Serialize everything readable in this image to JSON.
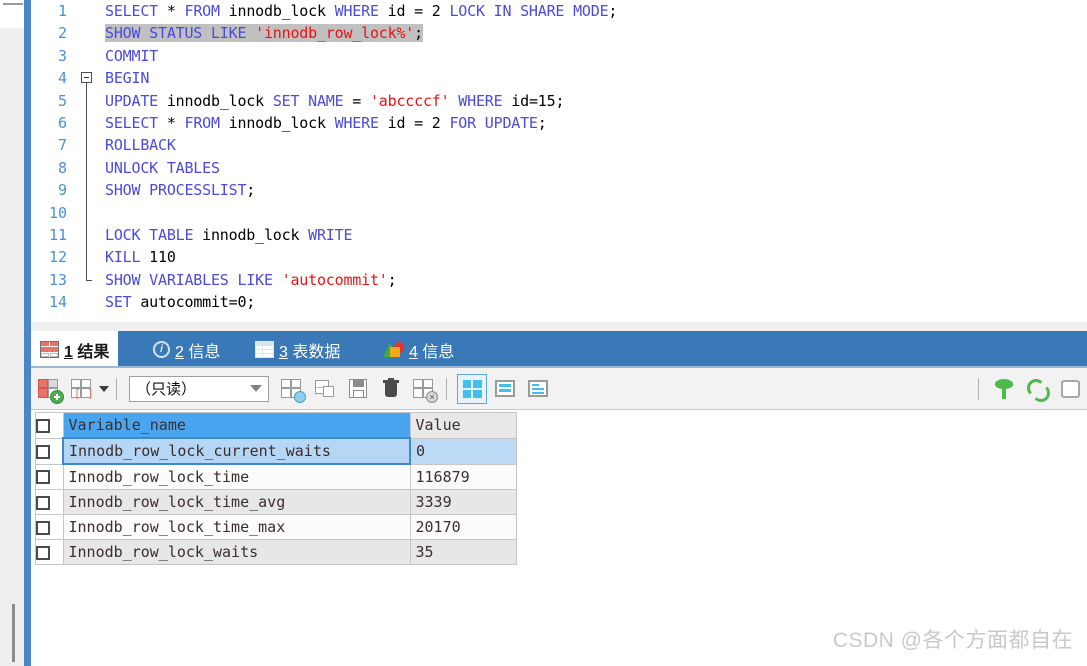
{
  "editor": {
    "lines": [
      {
        "n": "1",
        "segments": [
          {
            "t": "SELECT",
            "c": "kw"
          },
          {
            "t": " * ",
            "c": "pl"
          },
          {
            "t": "FROM",
            "c": "kw"
          },
          {
            "t": " innodb_lock ",
            "c": "pl"
          },
          {
            "t": "WHERE",
            "c": "kw"
          },
          {
            "t": " id = 2 ",
            "c": "pl"
          },
          {
            "t": "LOCK IN SHARE MODE",
            "c": "kw"
          },
          {
            "t": ";",
            "c": "pl"
          }
        ]
      },
      {
        "n": "2",
        "highlight": true,
        "segments": [
          {
            "t": "SHOW STATUS LIKE",
            "c": "kw"
          },
          {
            "t": " ",
            "c": "pl"
          },
          {
            "t": "'innodb_row_lock%'",
            "c": "str"
          },
          {
            "t": ";",
            "c": "pl"
          }
        ]
      },
      {
        "n": "3",
        "segments": [
          {
            "t": "COMMIT",
            "c": "kw"
          }
        ]
      },
      {
        "n": "4",
        "fold": "start",
        "segments": [
          {
            "t": "BEGIN",
            "c": "kw"
          }
        ]
      },
      {
        "n": "5",
        "segments": [
          {
            "t": "UPDATE",
            "c": "kw"
          },
          {
            "t": " innodb_lock ",
            "c": "pl"
          },
          {
            "t": "SET NAME",
            "c": "kw"
          },
          {
            "t": " = ",
            "c": "pl"
          },
          {
            "t": "'abccccf'",
            "c": "str"
          },
          {
            "t": " ",
            "c": "pl"
          },
          {
            "t": "WHERE",
            "c": "kw"
          },
          {
            "t": " id=15;",
            "c": "pl"
          }
        ]
      },
      {
        "n": "6",
        "segments": [
          {
            "t": "SELECT",
            "c": "kw"
          },
          {
            "t": " * ",
            "c": "pl"
          },
          {
            "t": "FROM",
            "c": "kw"
          },
          {
            "t": " innodb_lock ",
            "c": "pl"
          },
          {
            "t": "WHERE",
            "c": "kw"
          },
          {
            "t": " id = 2 ",
            "c": "pl"
          },
          {
            "t": "FOR UPDATE",
            "c": "kw"
          },
          {
            "t": ";",
            "c": "pl"
          }
        ]
      },
      {
        "n": "7",
        "segments": [
          {
            "t": "ROLLBACK",
            "c": "kw"
          }
        ]
      },
      {
        "n": "8",
        "segments": [
          {
            "t": "UNLOCK TABLES",
            "c": "kw"
          }
        ]
      },
      {
        "n": "9",
        "segments": [
          {
            "t": "SHOW PROCESSLIST",
            "c": "kw"
          },
          {
            "t": ";",
            "c": "pl"
          }
        ]
      },
      {
        "n": "10",
        "segments": []
      },
      {
        "n": "11",
        "segments": [
          {
            "t": "LOCK TABLE",
            "c": "kw"
          },
          {
            "t": " innodb_lock ",
            "c": "pl"
          },
          {
            "t": "WRITE",
            "c": "kw"
          }
        ]
      },
      {
        "n": "12",
        "segments": [
          {
            "t": "KILL",
            "c": "kw"
          },
          {
            "t": " 110",
            "c": "pl"
          }
        ]
      },
      {
        "n": "13",
        "fold": "end",
        "segments": [
          {
            "t": "SHOW VARIABLES LIKE",
            "c": "kw"
          },
          {
            "t": " ",
            "c": "pl"
          },
          {
            "t": "'autocommit'",
            "c": "str"
          },
          {
            "t": ";",
            "c": "pl"
          }
        ]
      },
      {
        "n": "14",
        "segments": [
          {
            "t": "SET",
            "c": "kw"
          },
          {
            "t": " autocommit=0;",
            "c": "pl"
          }
        ]
      }
    ]
  },
  "tabs": [
    {
      "num": "1",
      "label": "结果",
      "icon": "result-grid-icon",
      "active": true
    },
    {
      "num": "2",
      "label": "信息",
      "icon": "info-circle-icon",
      "active": false
    },
    {
      "num": "3",
      "label": "表数据",
      "icon": "table-data-icon",
      "active": false
    },
    {
      "num": "4",
      "label": "信息",
      "icon": "chart-pie-icon",
      "active": false
    }
  ],
  "toolbar": {
    "buttons": [
      {
        "name": "apply-changes-button",
        "tooltip": "应用"
      },
      {
        "name": "insert-record-button",
        "tooltip": "插入"
      },
      {
        "name": "export-wizard-button",
        "tooltip": "导出向导"
      },
      {
        "name": "duplicate-record-button",
        "tooltip": "复制"
      },
      {
        "name": "save-button",
        "tooltip": "保存"
      },
      {
        "name": "delete-record-button",
        "tooltip": "删除"
      },
      {
        "name": "cancel-changes-button",
        "tooltip": "取消"
      }
    ],
    "mode_select": {
      "value": "（只读）"
    },
    "view_modes": [
      {
        "name": "grid-view-button",
        "active": true
      },
      {
        "name": "form-view-button",
        "active": false
      },
      {
        "name": "text-view-button",
        "active": false
      }
    ],
    "right_tools": [
      {
        "name": "filter-icon"
      },
      {
        "name": "refresh-icon"
      },
      {
        "name": "stop-icon"
      }
    ]
  },
  "result_grid": {
    "columns": [
      "Variable_name",
      "Value"
    ],
    "selected_column": "Variable_name",
    "selected_row_index": 0,
    "rows": [
      {
        "variable": "Innodb_row_lock_current_waits",
        "value": "0"
      },
      {
        "variable": "Innodb_row_lock_time",
        "value": "116879"
      },
      {
        "variable": "Innodb_row_lock_time_avg",
        "value": "3339"
      },
      {
        "variable": "Innodb_row_lock_time_max",
        "value": "20170"
      },
      {
        "variable": "Innodb_row_lock_waits",
        "value": "35"
      }
    ]
  },
  "watermark": {
    "text": "CSDN @各个方面都自在"
  },
  "colors": {
    "tabbar_blue": "#3a79b8",
    "splitter_blue": "#4a86c8",
    "header_blue": "#49a5ef",
    "selection_blue": "#b6d6f5",
    "keyword": "#4b49e0",
    "string": "#ee1111",
    "linenum": "#4a90d9"
  }
}
